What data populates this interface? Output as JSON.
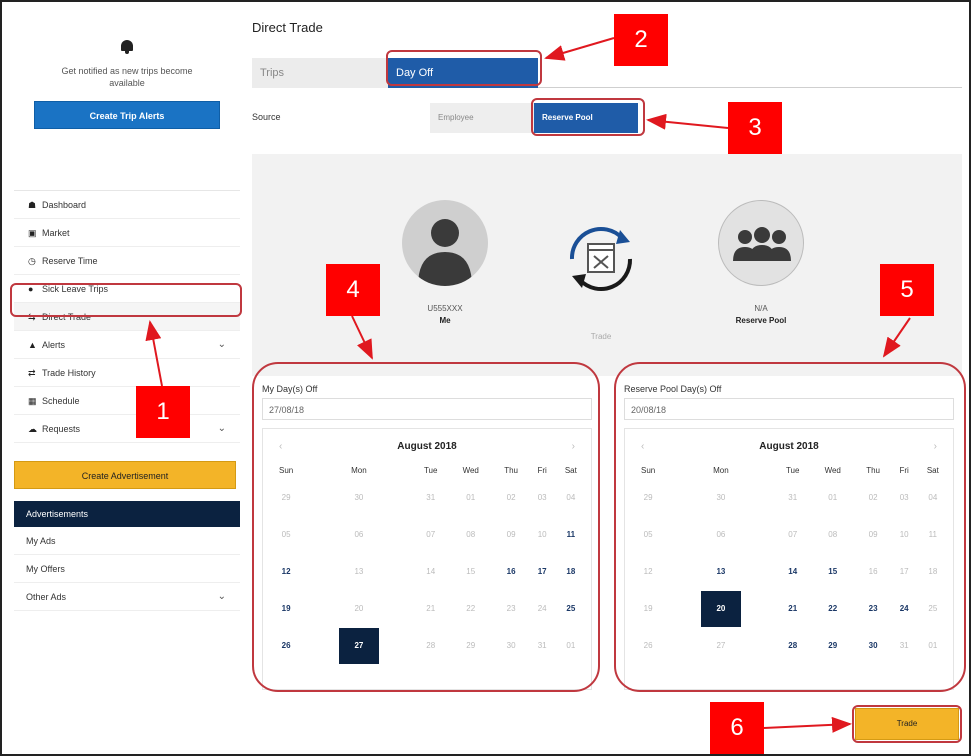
{
  "sidebar": {
    "notify_text": "Get notified as new trips become available",
    "create_trip_alerts": "Create Trip Alerts",
    "nav": [
      {
        "label": "Dashboard",
        "icon": "dashboard-icon",
        "glyph": "☗"
      },
      {
        "label": "Market",
        "icon": "market-icon",
        "glyph": "▣"
      },
      {
        "label": "Reserve Time",
        "icon": "clock-icon",
        "glyph": "◷"
      },
      {
        "label": "Sick Leave Trips",
        "icon": "sick-leave-icon",
        "glyph": "●"
      },
      {
        "label": "Direct Trade",
        "icon": "trade-arrows-icon",
        "glyph": "⇆"
      },
      {
        "label": "Alerts",
        "icon": "bell-icon",
        "glyph": "▲"
      },
      {
        "label": "Trade History",
        "icon": "history-icon",
        "glyph": "⇄"
      },
      {
        "label": "Schedule",
        "icon": "calendar-icon",
        "glyph": "▦"
      },
      {
        "label": "Requests",
        "icon": "requests-icon",
        "glyph": "☁"
      }
    ],
    "create_advertisement": "Create Advertisement",
    "ads_header": "Advertisements",
    "ads": [
      "My Ads",
      "My Offers",
      "Other Ads"
    ]
  },
  "main": {
    "title": "Direct Trade",
    "tabs": [
      "Trips",
      "Day Off"
    ],
    "source_label": "Source",
    "source_options": [
      "Employee",
      "Reserve Pool"
    ],
    "me": {
      "id": "U555XXX",
      "name": "Me"
    },
    "trade_caption": "Trade",
    "pool": {
      "id": "N/A",
      "name": "Reserve Pool"
    },
    "trade_button": "Trade"
  },
  "pickers": {
    "left": {
      "label": "My Day(s) Off",
      "value": "27/08/18",
      "month": "August 2018",
      "weekdays": [
        "Sun",
        "Mon",
        "Tue",
        "Wed",
        "Thu",
        "Fri",
        "Sat"
      ],
      "weeks": [
        [
          "29",
          "30",
          "31",
          "01",
          "02",
          "03",
          "04"
        ],
        [
          "05",
          "06",
          "07",
          "08",
          "09",
          "10",
          "11"
        ],
        [
          "12",
          "13",
          "14",
          "15",
          "16",
          "17",
          "18"
        ],
        [
          "19",
          "20",
          "21",
          "22",
          "23",
          "24",
          "25"
        ],
        [
          "26",
          "27",
          "28",
          "29",
          "30",
          "31",
          "01"
        ]
      ]
    },
    "right": {
      "label": "Reserve Pool Day(s) Off",
      "value": "20/08/18",
      "month": "August 2018",
      "weekdays": [
        "Sun",
        "Mon",
        "Tue",
        "Wed",
        "Thu",
        "Fri",
        "Sat"
      ],
      "weeks": [
        [
          "29",
          "30",
          "31",
          "01",
          "02",
          "03",
          "04"
        ],
        [
          "05",
          "06",
          "07",
          "08",
          "09",
          "10",
          "11"
        ],
        [
          "12",
          "13",
          "14",
          "15",
          "16",
          "17",
          "18"
        ],
        [
          "19",
          "20",
          "21",
          "22",
          "23",
          "24",
          "25"
        ],
        [
          "26",
          "27",
          "28",
          "29",
          "30",
          "31",
          "01"
        ]
      ]
    }
  },
  "callouts": [
    "1",
    "2",
    "3",
    "4",
    "5",
    "6"
  ],
  "colors": {
    "brand_blue": "#1f5ca8",
    "navy": "#0b2240",
    "yellow": "#f3b428",
    "callout_red": "#ff0000"
  }
}
